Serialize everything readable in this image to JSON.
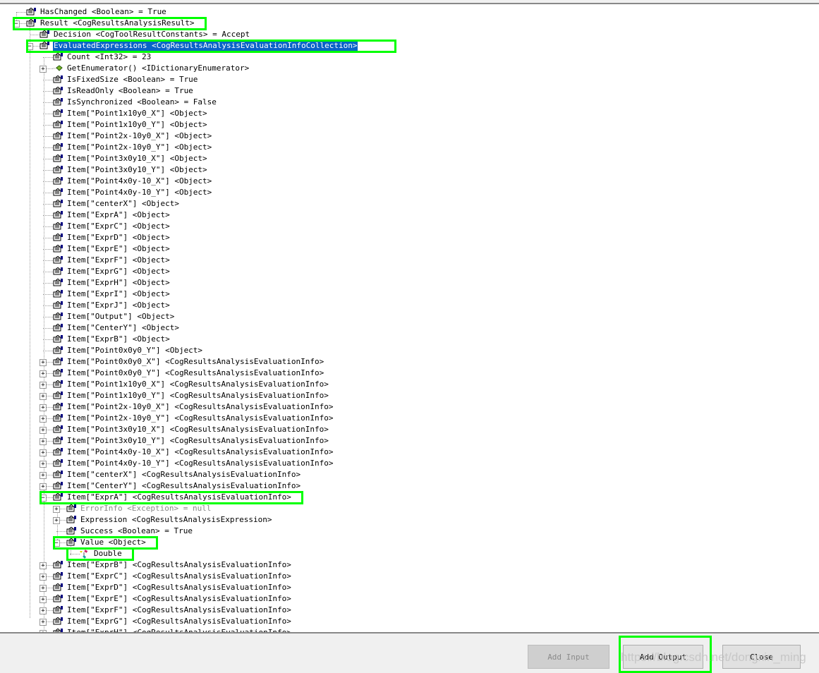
{
  "tree": [
    {
      "level": 0,
      "text": "HasChanged <Boolean> = True",
      "icon": "property-icon"
    },
    {
      "level": 0,
      "text": "Result <CogResultsAnalysisResult>",
      "icon": "property-icon",
      "exp": "-",
      "hl": true
    },
    {
      "level": 1,
      "text": "Decision <CogToolResultConstants> = Accept",
      "icon": "property-icon"
    },
    {
      "level": 1,
      "text": "EvaluatedExpressions <CogResultsAnalysisEvaluationInfoCollection>",
      "icon": "property-icon",
      "exp": "-",
      "sel": true,
      "hl": true
    },
    {
      "level": 2,
      "text": "Count <Int32> = 23",
      "icon": "property-icon"
    },
    {
      "level": 2,
      "text": "GetEnumerator() <IDictionaryEnumerator>",
      "icon": "method-icon",
      "exp": "+"
    },
    {
      "level": 2,
      "text": "IsFixedSize <Boolean> = True",
      "icon": "property-icon"
    },
    {
      "level": 2,
      "text": "IsReadOnly <Boolean> = True",
      "icon": "property-icon"
    },
    {
      "level": 2,
      "text": "IsSynchronized <Boolean> = False",
      "icon": "property-icon"
    },
    {
      "level": 2,
      "text": "Item[\"Point1x10y0_X\"] <Object>",
      "icon": "property-icon"
    },
    {
      "level": 2,
      "text": "Item[\"Point1x10y0_Y\"] <Object>",
      "icon": "property-icon"
    },
    {
      "level": 2,
      "text": "Item[\"Point2x-10y0_X\"] <Object>",
      "icon": "property-icon"
    },
    {
      "level": 2,
      "text": "Item[\"Point2x-10y0_Y\"] <Object>",
      "icon": "property-icon"
    },
    {
      "level": 2,
      "text": "Item[\"Point3x0y10_X\"] <Object>",
      "icon": "property-icon"
    },
    {
      "level": 2,
      "text": "Item[\"Point3x0y10_Y\"] <Object>",
      "icon": "property-icon"
    },
    {
      "level": 2,
      "text": "Item[\"Point4x0y-10_X\"] <Object>",
      "icon": "property-icon"
    },
    {
      "level": 2,
      "text": "Item[\"Point4x0y-10_Y\"] <Object>",
      "icon": "property-icon"
    },
    {
      "level": 2,
      "text": "Item[\"centerX\"] <Object>",
      "icon": "property-icon"
    },
    {
      "level": 2,
      "text": "Item[\"ExprA\"] <Object>",
      "icon": "property-icon"
    },
    {
      "level": 2,
      "text": "Item[\"ExprC\"] <Object>",
      "icon": "property-icon"
    },
    {
      "level": 2,
      "text": "Item[\"ExprD\"] <Object>",
      "icon": "property-icon"
    },
    {
      "level": 2,
      "text": "Item[\"ExprE\"] <Object>",
      "icon": "property-icon"
    },
    {
      "level": 2,
      "text": "Item[\"ExprF\"] <Object>",
      "icon": "property-icon"
    },
    {
      "level": 2,
      "text": "Item[\"ExprG\"] <Object>",
      "icon": "property-icon"
    },
    {
      "level": 2,
      "text": "Item[\"ExprH\"] <Object>",
      "icon": "property-icon"
    },
    {
      "level": 2,
      "text": "Item[\"ExprI\"] <Object>",
      "icon": "property-icon"
    },
    {
      "level": 2,
      "text": "Item[\"ExprJ\"] <Object>",
      "icon": "property-icon"
    },
    {
      "level": 2,
      "text": "Item[\"Output\"] <Object>",
      "icon": "property-icon"
    },
    {
      "level": 2,
      "text": "Item[\"CenterY\"] <Object>",
      "icon": "property-icon"
    },
    {
      "level": 2,
      "text": "Item[\"ExprB\"] <Object>",
      "icon": "property-icon"
    },
    {
      "level": 2,
      "text": "Item[\"Point0x0y0_Y\"] <Object>",
      "icon": "property-icon"
    },
    {
      "level": 2,
      "text": "Item[\"Point0x0y0_X\"] <CogResultsAnalysisEvaluationInfo>",
      "icon": "property-icon",
      "exp": "+"
    },
    {
      "level": 2,
      "text": "Item[\"Point0x0y0_Y\"] <CogResultsAnalysisEvaluationInfo>",
      "icon": "property-icon",
      "exp": "+"
    },
    {
      "level": 2,
      "text": "Item[\"Point1x10y0_X\"] <CogResultsAnalysisEvaluationInfo>",
      "icon": "property-icon",
      "exp": "+"
    },
    {
      "level": 2,
      "text": "Item[\"Point1x10y0_Y\"] <CogResultsAnalysisEvaluationInfo>",
      "icon": "property-icon",
      "exp": "+"
    },
    {
      "level": 2,
      "text": "Item[\"Point2x-10y0_X\"] <CogResultsAnalysisEvaluationInfo>",
      "icon": "property-icon",
      "exp": "+"
    },
    {
      "level": 2,
      "text": "Item[\"Point2x-10y0_Y\"] <CogResultsAnalysisEvaluationInfo>",
      "icon": "property-icon",
      "exp": "+"
    },
    {
      "level": 2,
      "text": "Item[\"Point3x0y10_X\"] <CogResultsAnalysisEvaluationInfo>",
      "icon": "property-icon",
      "exp": "+"
    },
    {
      "level": 2,
      "text": "Item[\"Point3x0y10_Y\"] <CogResultsAnalysisEvaluationInfo>",
      "icon": "property-icon",
      "exp": "+"
    },
    {
      "level": 2,
      "text": "Item[\"Point4x0y-10_X\"] <CogResultsAnalysisEvaluationInfo>",
      "icon": "property-icon",
      "exp": "+"
    },
    {
      "level": 2,
      "text": "Item[\"Point4x0y-10_Y\"] <CogResultsAnalysisEvaluationInfo>",
      "icon": "property-icon",
      "exp": "+"
    },
    {
      "level": 2,
      "text": "Item[\"centerX\"] <CogResultsAnalysisEvaluationInfo>",
      "icon": "property-icon",
      "exp": "+"
    },
    {
      "level": 2,
      "text": "Item[\"CenterY\"] <CogResultsAnalysisEvaluationInfo>",
      "icon": "property-icon",
      "exp": "+"
    },
    {
      "level": 2,
      "text": "Item[\"ExprA\"] <CogResultsAnalysisEvaluationInfo>",
      "icon": "property-icon",
      "exp": "-",
      "hl": true
    },
    {
      "level": 3,
      "text": "ErrorInfo <Exception> = null",
      "icon": "property-icon",
      "exp": "+",
      "gray": true
    },
    {
      "level": 3,
      "text": "Expression <CogResultsAnalysisExpression>",
      "icon": "property-icon",
      "exp": "+"
    },
    {
      "level": 3,
      "text": "Success <Boolean> = True",
      "icon": "property-icon"
    },
    {
      "level": 3,
      "text": "Value <Object>",
      "icon": "property-icon",
      "exp": "-",
      "hl": true
    },
    {
      "level": 4,
      "text": "Double",
      "icon": "type-icon",
      "hl": true
    },
    {
      "level": 2,
      "text": "Item[\"ExprB\"] <CogResultsAnalysisEvaluationInfo>",
      "icon": "property-icon",
      "exp": "+"
    },
    {
      "level": 2,
      "text": "Item[\"ExprC\"] <CogResultsAnalysisEvaluationInfo>",
      "icon": "property-icon",
      "exp": "+"
    },
    {
      "level": 2,
      "text": "Item[\"ExprD\"] <CogResultsAnalysisEvaluationInfo>",
      "icon": "property-icon",
      "exp": "+"
    },
    {
      "level": 2,
      "text": "Item[\"ExprE\"] <CogResultsAnalysisEvaluationInfo>",
      "icon": "property-icon",
      "exp": "+"
    },
    {
      "level": 2,
      "text": "Item[\"ExprF\"] <CogResultsAnalysisEvaluationInfo>",
      "icon": "property-icon",
      "exp": "+"
    },
    {
      "level": 2,
      "text": "Item[\"ExprG\"] <CogResultsAnalysisEvaluationInfo>",
      "icon": "property-icon",
      "exp": "+"
    },
    {
      "level": 2,
      "text": "Item[\"ExprH\"] <CogResultsAnalysisEvaluationInfo>",
      "icon": "property-icon",
      "exp": "+"
    }
  ],
  "buttons": {
    "add_input": "Add Input",
    "add_output": "Add Output",
    "close": "Close"
  },
  "watermark": "https://blog.csdn.net/dongxin_ming",
  "colors": {
    "highlight": "#00ff00",
    "selection": "#0a64c8"
  }
}
